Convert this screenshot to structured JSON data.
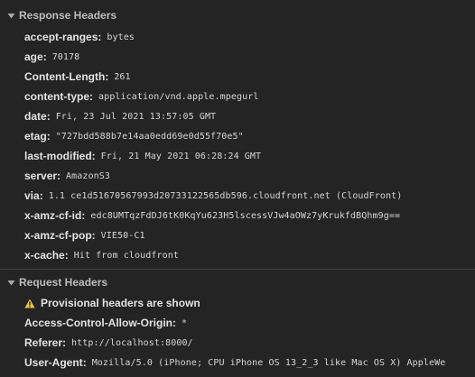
{
  "response_section": {
    "title": "Response Headers",
    "icon": "triangle-down-icon",
    "headers": [
      {
        "name": "accept-ranges",
        "value": "bytes"
      },
      {
        "name": "age",
        "value": "70178"
      },
      {
        "name": "Content-Length",
        "value": "261"
      },
      {
        "name": "content-type",
        "value": "application/vnd.apple.mpegurl"
      },
      {
        "name": "date",
        "value": "Fri, 23 Jul 2021 13:57:05 GMT"
      },
      {
        "name": "etag",
        "value": "\"727bdd588b7e14aa0edd69e0d55f70e5\""
      },
      {
        "name": "last-modified",
        "value": "Fri, 21 May 2021 06:28:24 GMT"
      },
      {
        "name": "server",
        "value": "AmazonS3"
      },
      {
        "name": "via",
        "value": "1.1 ce1d51670567993d20733122565db596.cloudfront.net (CloudFront)"
      },
      {
        "name": "x-amz-cf-id",
        "value": "edc8UMTqzFdDJ6tK0KqYu623H5lscessVJw4aOWz7yKrukfdBQhm9g=="
      },
      {
        "name": "x-amz-cf-pop",
        "value": "VIE50-C1"
      },
      {
        "name": "x-cache",
        "value": "Hit from cloudfront"
      }
    ]
  },
  "request_section": {
    "title": "Request Headers",
    "icon": "triangle-down-icon",
    "warning": {
      "icon": "warning-icon",
      "text": "Provisional headers are shown",
      "color": "#f0c43c"
    },
    "headers": [
      {
        "name": "Access-Control-Allow-Origin",
        "value": "*"
      },
      {
        "name": "Referer",
        "value": "http://localhost:8000/"
      },
      {
        "name": "User-Agent",
        "value": "Mozilla/5.0 (iPhone; CPU iPhone OS 13_2_3 like Mac OS X) AppleWe"
      }
    ]
  },
  "colors": {
    "background": "#242424",
    "divider": "#3d3d3d",
    "text": "#e3e3e3",
    "section_title": "#bdbdbd"
  }
}
